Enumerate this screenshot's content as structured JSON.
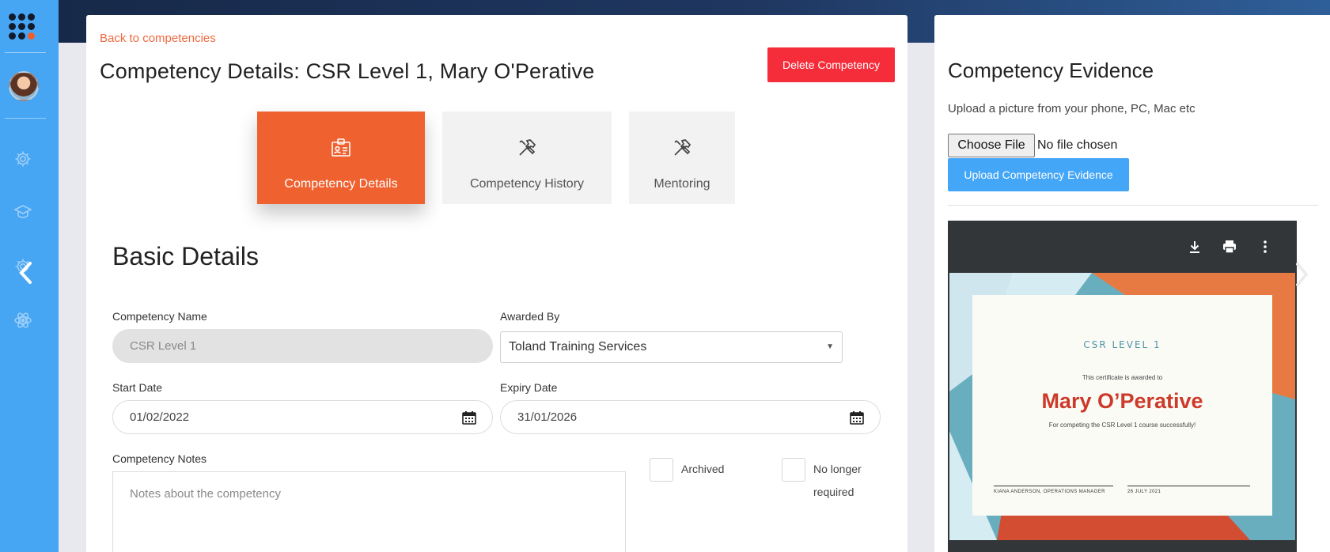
{
  "sidebar": {
    "items": [
      {
        "icon": "gear-icon"
      },
      {
        "icon": "graduation-cap-icon"
      },
      {
        "icon": "gear-icon"
      },
      {
        "icon": "atom-icon"
      }
    ],
    "collapse_icon": "chevron-left-icon"
  },
  "colors": {
    "sidebar": "#47a6f4",
    "accent_orange": "#ef612f",
    "danger": "#f52d3a",
    "primary_blue": "#44a6f7"
  },
  "header": {
    "back_link": "Back to competencies",
    "title": "Competency Details: CSR Level 1, Mary O'Perative",
    "delete_button": "Delete Competency"
  },
  "tabs": [
    {
      "label": "Competency Details",
      "icon": "id-badge-icon",
      "active": true
    },
    {
      "label": "Competency History",
      "icon": "tools-icon",
      "active": false
    },
    {
      "label": "Mentoring",
      "icon": "tools-icon",
      "active": false
    }
  ],
  "basic_details": {
    "title": "Basic Details",
    "competency_name": {
      "label": "Competency Name",
      "value": "CSR Level 1"
    },
    "awarded_by": {
      "label": "Awarded By",
      "value": "Toland Training Services"
    },
    "start_date": {
      "label": "Start Date",
      "value": "01/02/2022"
    },
    "expiry_date": {
      "label": "Expiry Date",
      "value": "31/01/2026"
    },
    "notes": {
      "label": "Competency Notes",
      "placeholder": "Notes about the competency"
    },
    "archived": {
      "label": "Archived",
      "checked": false
    },
    "no_longer_required": {
      "label": "No longer required",
      "checked": false
    }
  },
  "evidence": {
    "title": "Competency Evidence",
    "subtitle": "Upload a picture from your phone, PC, Mac etc",
    "choose_file": "Choose File",
    "no_file": "No file chosen",
    "upload_button": "Upload Competency Evidence",
    "viewer_tools": [
      "download-icon",
      "print-icon",
      "more-vertical-icon"
    ],
    "certificate": {
      "heading": "CSR LEVEL 1",
      "awarded_to": "This certificate is awarded to",
      "name": "Mary O’Perative",
      "reason": "For competing the CSR Level 1 course successfully!",
      "signatory": "KIANA ANDERSON, OPERATIONS MANAGER",
      "date": "26 JULY 2021"
    }
  }
}
